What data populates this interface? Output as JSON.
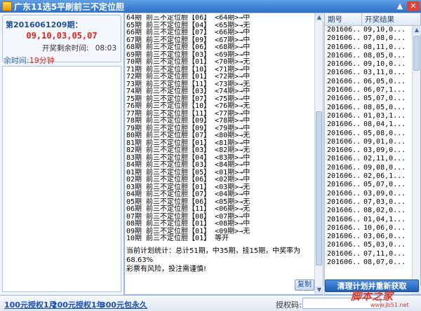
{
  "window": {
    "title": "广东11选5平刷前三不定位胆",
    "minimize_glyph": "▲",
    "close_glyph": "✕"
  },
  "current_issue": {
    "title": "第2016061209期：",
    "numbers": "09,10,03,05,07",
    "countdown_label": "开奖剩余时间:",
    "countdown_value": "08:03",
    "remaining_label": "余时间:",
    "remaining_value": "19分钟"
  },
  "plan": {
    "lines": [
      "64期 前三不定位胆【06】 <64期>→中",
      "65期 前三不定位胆【04】 <65期>→无",
      "66期 前三不定位胆【07】 <66期>→中",
      "67期 前三不定位胆【09】 <67期>→中",
      "68期 前三不定位胆【06】 <68期>→中",
      "69期 前三不定位胆【03】 <69期>→中",
      "70期 前三不定位胆【01】 <70期>→无",
      "71期 前三不定位胆【10】 <71期>→中",
      "72期 前三不定位胆【01】 <72期>→中",
      "73期 前三不定位胆【11】 <73期>→无",
      "74期 前三不定位胆【03】 <74期>→中",
      "75期 前三不定位胆【07】 <75期>→中",
      "76期 前三不定位胆【10】 <76期>→无",
      "77期 前三不定位胆【11】 <77期>→中",
      "78期 前三不定位胆【09】 <78期>→中",
      "79期 前三不定位胆【09】 <79期>→中",
      "80期 前三不定位胆【07】 <80期>→无",
      "81期 前三不定位胆【01】 <81期>→中",
      "82期 前三不定位胆【03】 <82期>→无",
      "83期 前三不定位胆【04】 <83期>→中",
      "84期 前三不定位胆【03】 <84期>→中",
      "01期 前三不定位胆【05】 <01期>→中",
      "02期 前三不定位胆【06】 <02期>→中",
      "03期 前三不定位胆【01】 <03期>→无",
      "04期 前三不定位胆【07】 <04期>→中",
      "05期 前三不定位胆【06】 <05期>→无",
      "06期 前三不定位胆【11】 <06期>→无",
      "07期 前三不定位胆【08】 <07期>→中",
      "08期 前三不定位胆【01】 <08期>→中",
      "09期 前三不定位胆【01】 <09期>→无",
      "10期 前三不定位胆【01】 等开"
    ],
    "summary_line1": "当前计划统计：总计51期，中35期，挂15期，中奖率为",
    "summary_line2": "68.63%",
    "summary_line3": "彩票有风险，投注需谨慎!"
  },
  "copy_button": "复制",
  "history": {
    "col_issue": "期号",
    "col_result": "开奖结果",
    "rows": [
      [
        "201606...",
        "09,10,0..."
      ],
      [
        "201606...",
        "07,08,0..."
      ],
      [
        "201606...",
        "08,11,0..."
      ],
      [
        "201606...",
        "08,05,0..."
      ],
      [
        "201606...",
        "09,10,0..."
      ],
      [
        "201606...",
        "03,11,0..."
      ],
      [
        "201606...",
        "06,05,0..."
      ],
      [
        "201606...",
        "06,07,1..."
      ],
      [
        "201606...",
        "05,07,0..."
      ],
      [
        "201606...",
        "08,05,0..."
      ],
      [
        "201606...",
        "01,03,1..."
      ],
      [
        "201606...",
        "08,04,1..."
      ],
      [
        "201606...",
        "05,08,0..."
      ],
      [
        "201606...",
        "09,01,0..."
      ],
      [
        "201606...",
        "03,09,0..."
      ],
      [
        "201606...",
        "02,11,0..."
      ],
      [
        "201606...",
        "09,08,0..."
      ],
      [
        "201606...",
        "02,06,1..."
      ],
      [
        "201606...",
        "05,07,0..."
      ],
      [
        "201606...",
        "03,09,0..."
      ],
      [
        "201606...",
        "07,03,0..."
      ],
      [
        "201606...",
        "08,02,0..."
      ],
      [
        "201606...",
        "01,04,1..."
      ],
      [
        "201606...",
        "10,06,0..."
      ],
      [
        "201606...",
        "03,06,0..."
      ],
      [
        "201606...",
        "05,03,0..."
      ],
      [
        "201606...",
        "07,11,0..."
      ],
      [
        "201606...",
        "08,07,0..."
      ]
    ]
  },
  "refresh_button": "清理计划并重新获取",
  "statusbar": {
    "link1": "100元授权1月",
    "link2": "200元授权1年",
    "link3": "300元包永久",
    "auth_label": "授权码:"
  },
  "watermark": {
    "main": "脚本之家",
    "sub": "www.jb51.net"
  }
}
